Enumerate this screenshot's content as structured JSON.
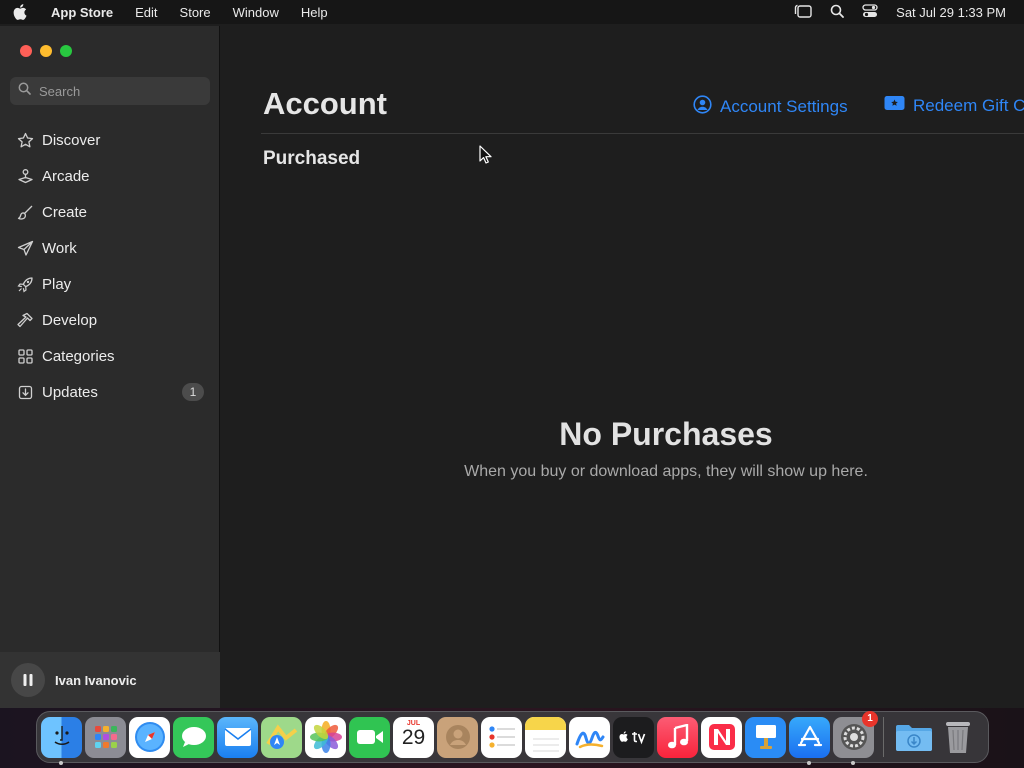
{
  "menubar": {
    "app_name": "App Store",
    "menus": [
      "Edit",
      "Store",
      "Window",
      "Help"
    ],
    "clock": "Sat Jul 29  1:33 PM"
  },
  "sidebar": {
    "search_placeholder": "Search",
    "items": [
      {
        "label": "Discover",
        "icon": "star-icon"
      },
      {
        "label": "Arcade",
        "icon": "joystick-icon"
      },
      {
        "label": "Create",
        "icon": "brush-icon"
      },
      {
        "label": "Work",
        "icon": "paper-plane-icon"
      },
      {
        "label": "Play",
        "icon": "rocket-icon"
      },
      {
        "label": "Develop",
        "icon": "hammer-icon"
      },
      {
        "label": "Categories",
        "icon": "grid-icon"
      },
      {
        "label": "Updates",
        "icon": "download-tray-icon",
        "badge": "1"
      }
    ],
    "account": {
      "name": "Ivan Ivanovic"
    }
  },
  "main": {
    "title": "Account",
    "links": {
      "settings": "Account Settings",
      "redeem": "Redeem Gift Card"
    },
    "section": "Purchased",
    "empty_title": "No Purchases",
    "empty_message": "When you buy or download apps, they will show up here."
  },
  "dock": {
    "apps": [
      {
        "name": "Finder",
        "color": "#3a8ef6",
        "running": true
      },
      {
        "name": "Launchpad",
        "color": "#8c8c94"
      },
      {
        "name": "Safari",
        "color": "#2f8cf0"
      },
      {
        "name": "Messages",
        "color": "#34c759"
      },
      {
        "name": "Mail",
        "color": "#3c9bf4"
      },
      {
        "name": "Maps",
        "color": "#5bc26a"
      },
      {
        "name": "Photos",
        "color": "#f2f2f2"
      },
      {
        "name": "FaceTime",
        "color": "#30c452"
      },
      {
        "name": "Calendar",
        "color": "#ffffff",
        "month": "JUL",
        "day": "29"
      },
      {
        "name": "Contacts",
        "color": "#c9a27a"
      },
      {
        "name": "Reminders",
        "color": "#ffffff"
      },
      {
        "name": "Notes",
        "color": "#f7d54a"
      },
      {
        "name": "Freeform",
        "color": "#ffffff"
      },
      {
        "name": "TV",
        "color": "#1c1c1e",
        "text": "tv"
      },
      {
        "name": "Music",
        "color": "#fb3b56"
      },
      {
        "name": "News",
        "color": "#ffffff"
      },
      {
        "name": "Keynote",
        "color": "#2a8cf5"
      },
      {
        "name": "App Store",
        "color": "#1d8ff6",
        "running": true
      },
      {
        "name": "System Settings",
        "color": "#8e8e93",
        "badge": "1",
        "running": true
      }
    ],
    "folders": [
      {
        "name": "Downloads",
        "color": "#56a7e6"
      },
      {
        "name": "Trash",
        "color": "#9a9a9e"
      }
    ]
  },
  "colors": {
    "accent": "#2f86f6",
    "sidebar_bg": "#2b2b2b",
    "main_bg": "#1e1e1e"
  }
}
